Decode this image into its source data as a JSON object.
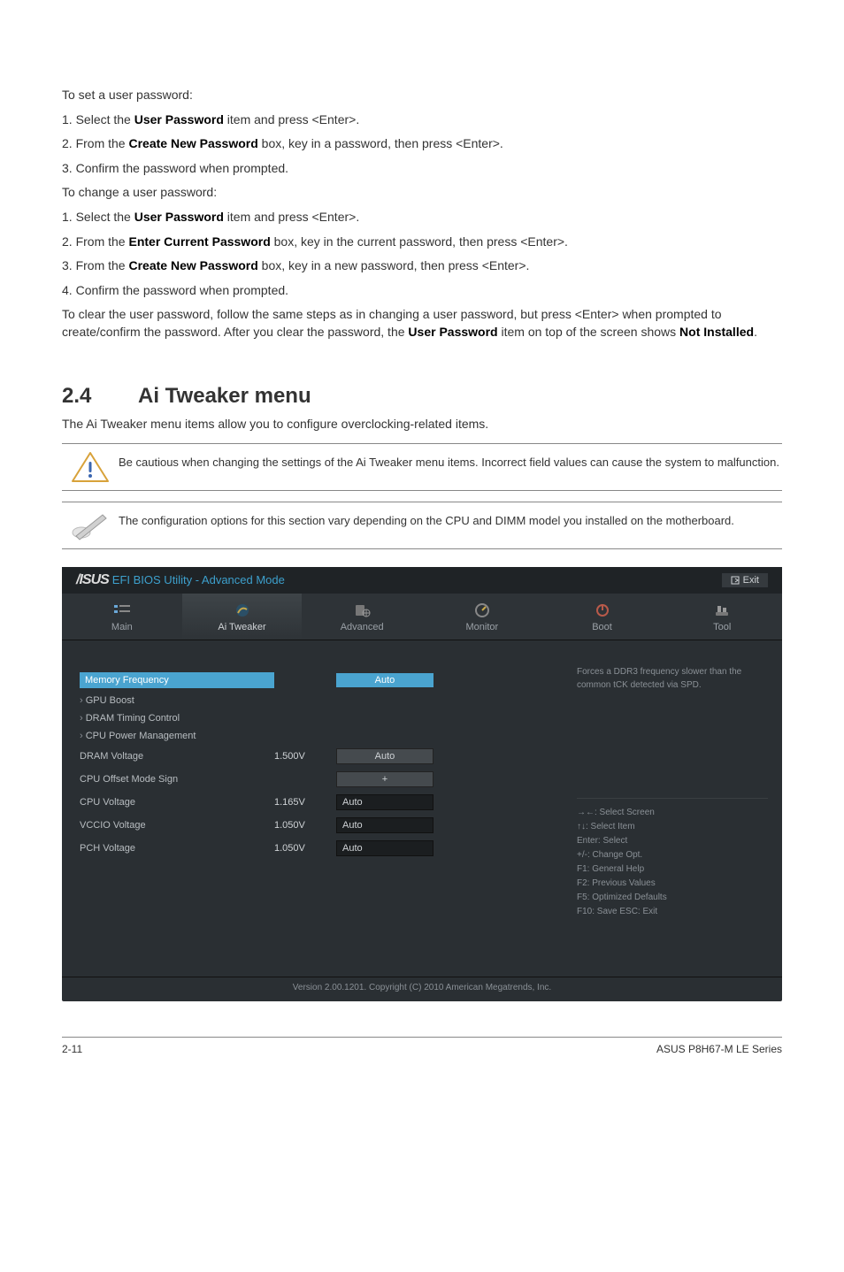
{
  "intro1": "To set a user password:",
  "steps1": [
    {
      "pre": "Select the ",
      "b": "User Password",
      "post": " item and press <Enter>."
    },
    {
      "pre": "From the ",
      "b": "Create New Password",
      "post": " box, key in a password, then press <Enter>."
    },
    {
      "pre": "Confirm the password when prompted.",
      "b": "",
      "post": ""
    }
  ],
  "intro2": "To change a user password:",
  "steps2": [
    {
      "pre": "Select the ",
      "b": "User Password",
      "post": " item and press <Enter>."
    },
    {
      "pre": "From the ",
      "b": "Enter Current Password",
      "post": " box, key in the current password, then press <Enter>."
    },
    {
      "pre": "From the ",
      "b": "Create New Password",
      "post": " box, key in a new password, then press <Enter>."
    },
    {
      "pre": "Confirm the password when prompted.",
      "b": "",
      "post": ""
    }
  ],
  "clearPara": {
    "t1": "To clear the user password, follow the same steps as in changing a user password, but press <Enter> when prompted to create/confirm the password. After you clear the password, the ",
    "b1": "User Password",
    "t2": " item on top of the screen shows ",
    "b2": "Not Installed",
    "t3": "."
  },
  "section": {
    "num": "2.4",
    "title": "Ai Tweaker menu"
  },
  "sectionDesc": "The Ai Tweaker menu items allow you to configure overclocking-related items.",
  "note1": "Be cautious when changing the settings of the Ai Tweaker menu items. Incorrect field values can cause the system to malfunction.",
  "note2": "The configuration options for this section vary depending on the CPU and DIMM model you installed on the motherboard.",
  "bios": {
    "title": "EFI BIOS Utility - Advanced Mode",
    "brand": "/ISUS",
    "exit": "Exit",
    "tabs": [
      "Main",
      "Ai  Tweaker",
      "Advanced",
      "Monitor",
      "Boot",
      "Tool"
    ],
    "rows": {
      "memfreq": {
        "label": "Memory Frequency",
        "field": "Auto"
      },
      "gpu": "GPU Boost",
      "dramtc": "DRAM Timing Control",
      "cpupm": "CPU Power Management",
      "dramv": {
        "label": "DRAM Voltage",
        "val": "1.500V",
        "field": "Auto"
      },
      "offset": {
        "label": "CPU Offset Mode Sign",
        "field": "+"
      },
      "cpuv": {
        "label": "CPU Voltage",
        "val": "1.165V",
        "field": "Auto"
      },
      "vccio": {
        "label": "VCCIO Voltage",
        "val": "1.050V",
        "field": "Auto"
      },
      "pch": {
        "label": "PCH Voltage",
        "val": "1.050V",
        "field": "Auto"
      }
    },
    "help": {
      "top": "Forces a DDR3 frequency slower than the common tCK detected via SPD.",
      "lines": [
        "→←: Select Screen",
        "↑↓: Select Item",
        "Enter: Select",
        "+/-: Change Opt.",
        "F1: General Help",
        "F2: Previous Values",
        "F5: Optimized Defaults",
        "F10: Save   ESC: Exit"
      ]
    },
    "foot": "Version  2.00.1201.   Copyright  (C)  2010  American  Megatrends,  Inc."
  },
  "footer": {
    "left": "2-11",
    "right": "ASUS P8H67-M LE Series"
  }
}
